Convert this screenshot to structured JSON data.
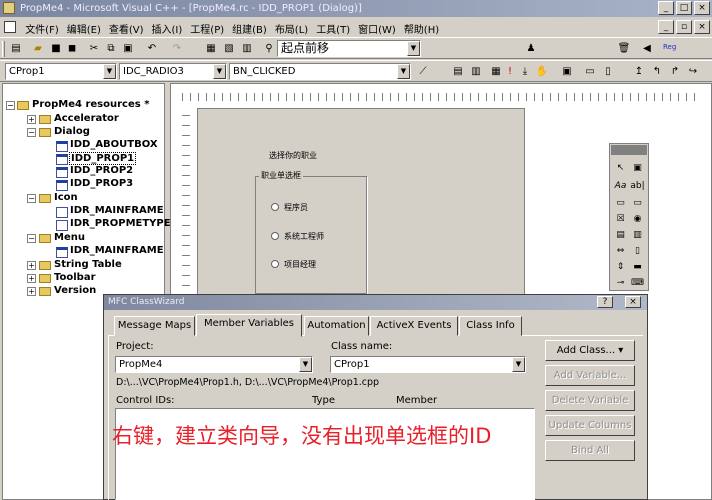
{
  "title": "PropMe4 - Microsoft Visual C++ - [PropMe4.rc - IDD_PROP1 (Dialog)]",
  "menu": [
    "文件(F)",
    "编辑(E)",
    "查看(V)",
    "插入(I)",
    "工程(P)",
    "组建(B)",
    "布局(L)",
    "工具(T)",
    "窗口(W)",
    "帮助(H)"
  ],
  "toolbar": {
    "find_combo": "起点前移",
    "class_combo": "CProp1",
    "id_combo": "IDC_RADIO3",
    "msg_combo": "BN_CLICKED",
    "reg_label": "Reg"
  },
  "tree": [
    {
      "label": "PropMe4 resources *",
      "bold": true
    },
    {
      "label": "Accelerator",
      "bold": true
    },
    {
      "label": "Dialog",
      "bold": true
    },
    {
      "label": "IDD_ABOUTBOX",
      "bold": true
    },
    {
      "label": "IDD_PROP1",
      "bold": true
    },
    {
      "label": "IDD_PROP2",
      "bold": true
    },
    {
      "label": "IDD_PROP3",
      "bold": true
    },
    {
      "label": "Icon",
      "bold": true
    },
    {
      "label": "IDR_MAINFRAME",
      "bold": true
    },
    {
      "label": "IDR_PROPMETYPE",
      "bold": true
    },
    {
      "label": "Menu",
      "bold": true
    },
    {
      "label": "IDR_MAINFRAME",
      "bold": true
    },
    {
      "label": "String Table",
      "bold": true
    },
    {
      "label": "Toolbar",
      "bold": true
    },
    {
      "label": "Version",
      "bold": true
    }
  ],
  "dialog": {
    "caption": "选择你的职业",
    "group": "职业单选框",
    "options": [
      "程序员",
      "系统工程师",
      "项目经理"
    ]
  },
  "classwizard": {
    "title": "MFC ClassWizard",
    "tabs": [
      "Message Maps",
      "Member Variables",
      "Automation",
      "ActiveX Events",
      "Class Info"
    ],
    "project_label": "Project:",
    "project_value": "PropMe4",
    "class_label": "Class name:",
    "class_value": "CProp1",
    "path": "D:\\...\\VC\\PropMe4\\Prop1.h, D:\\...\\VC\\PropMe4\\Prop1.cpp",
    "col_ids": "Control IDs:",
    "col_type": "Type",
    "col_member": "Member",
    "buttons": [
      "Add Class... ▾",
      "Add Variable...",
      "Delete Variable",
      "Update Columns",
      "Bind All"
    ]
  },
  "annotation": "右键，建立类向导，没有出现单选框的ID",
  "colors": {
    "annotation": "#e8202a",
    "title_bar": "#7a86a0"
  }
}
